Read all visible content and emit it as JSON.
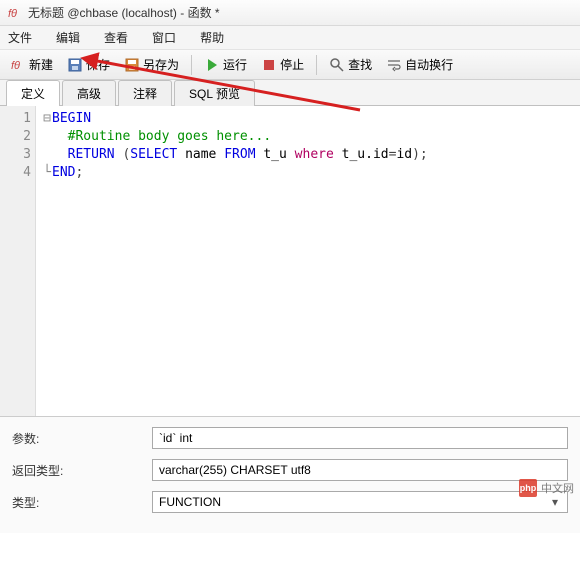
{
  "window": {
    "title": "无标题 @chbase (localhost) - 函数 *"
  },
  "menu": {
    "file": "文件",
    "edit": "编辑",
    "view": "查看",
    "window": "窗口",
    "help": "帮助"
  },
  "toolbar": {
    "new": "新建",
    "save": "保存",
    "saveas": "另存为",
    "run": "运行",
    "stop": "停止",
    "find": "查找",
    "wrap": "自动换行"
  },
  "tabs": {
    "define": "定义",
    "advanced": "高级",
    "comment": "注释",
    "sqlpreview": "SQL 预览"
  },
  "code": {
    "line1": "BEGIN",
    "line2": "  #Routine body goes here...",
    "line3a": "  RETURN ",
    "line3b": "(",
    "line3c": "SELECT",
    "line3d": " name ",
    "line3e": "FROM",
    "line3f": " t_u ",
    "line3g": "where",
    "line3h": " t_u.id",
    "line3i": "=",
    "line3j": "id",
    "line3k": ")",
    "line3l": ";",
    "line4": "END",
    "line4b": ";"
  },
  "gutter": {
    "l1": "1",
    "l2": "2",
    "l3": "3",
    "l4": "4"
  },
  "form": {
    "params_label": "参数:",
    "params_value": "`id` int",
    "return_label": "返回类型:",
    "return_value": "varchar(255) CHARSET utf8",
    "type_label": "类型:",
    "type_value": "FUNCTION"
  },
  "watermark": {
    "logo": "php",
    "text": "中文网"
  }
}
